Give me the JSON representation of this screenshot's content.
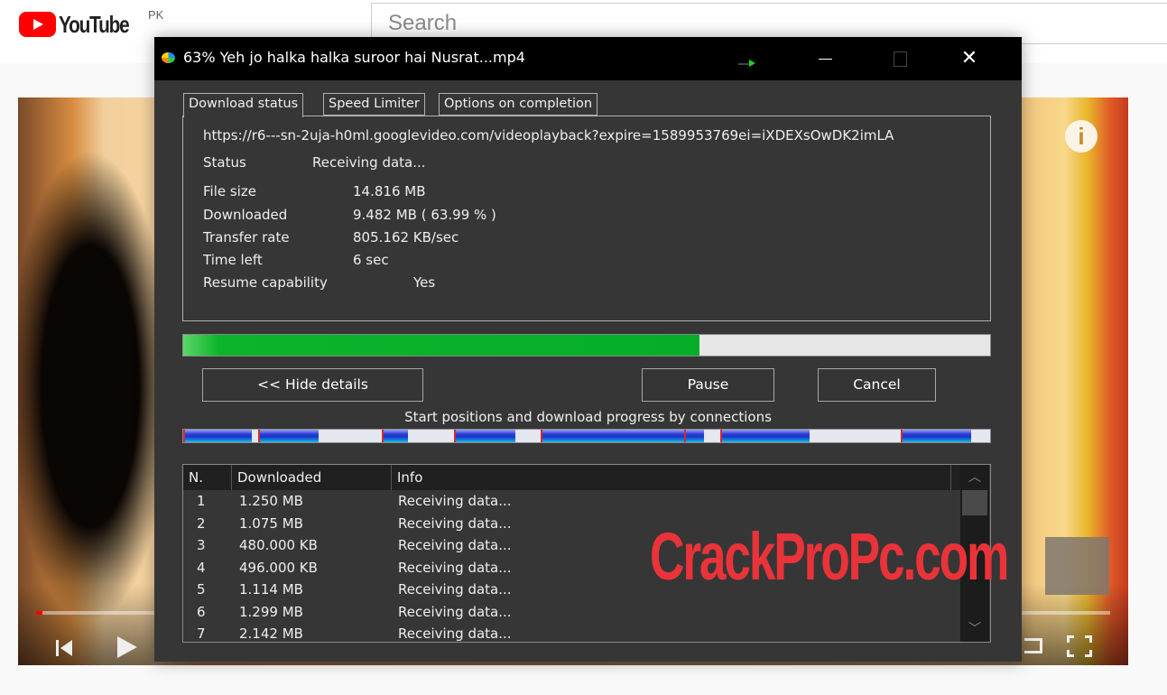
{
  "youtube": {
    "logo_text": "YouTube",
    "country_code": "PK",
    "search_placeholder": "Search",
    "video": {
      "played_fraction": 0.006,
      "info_icon": "i"
    }
  },
  "idm": {
    "title": "63% Yeh jo halka halka suroor hai Nusrat...mp4",
    "tabs": [
      {
        "label": "Download status",
        "active": true
      },
      {
        "label": "Speed Limiter",
        "active": false
      },
      {
        "label": "Options on completion",
        "active": false
      }
    ],
    "url": "https://r6---sn-2uja-h0ml.googlevideo.com/videoplayback?expire=1589953769ei=iXDEXsOwDK2imLA",
    "status": {
      "label": "Status",
      "value": "Receiving data..."
    },
    "details": [
      {
        "label": "File size",
        "value": "14.816  MB"
      },
      {
        "label": "Downloaded",
        "value": "9.482  MB  ( 63.99 % )"
      },
      {
        "label": "Transfer rate",
        "value": "805.162  KB/sec"
      },
      {
        "label": "Time left",
        "value": "6 sec"
      },
      {
        "label": "Resume capability",
        "value": "Yes"
      }
    ],
    "progress_percent": 63.99,
    "buttons": {
      "hide_details": "<< Hide details",
      "pause": "Pause",
      "cancel": "Cancel"
    },
    "connections_label": "Start positions and download progress by connections",
    "connections_bar": [
      {
        "start": 0.0,
        "done": 0.085
      },
      {
        "start": 0.093,
        "done": 0.075
      },
      {
        "start": 0.246,
        "done": 0.033
      },
      {
        "start": 0.336,
        "done": 0.076
      },
      {
        "start": 0.443,
        "done": 0.186
      },
      {
        "start": 0.621,
        "done": 0.024
      },
      {
        "start": 0.666,
        "done": 0.11
      },
      {
        "start": 0.889,
        "done": 0.087
      }
    ],
    "table": {
      "columns": [
        "N.",
        "Downloaded",
        "Info"
      ],
      "rows": [
        {
          "n": "1",
          "downloaded": "1.250  MB",
          "info": "Receiving data..."
        },
        {
          "n": "2",
          "downloaded": "1.075  MB",
          "info": "Receiving data..."
        },
        {
          "n": "3",
          "downloaded": "480.000  KB",
          "info": "Receiving data..."
        },
        {
          "n": "4",
          "downloaded": "496.000  KB",
          "info": "Receiving data..."
        },
        {
          "n": "5",
          "downloaded": "1.114  MB",
          "info": "Receiving data..."
        },
        {
          "n": "6",
          "downloaded": "1.299  MB",
          "info": "Receiving data..."
        },
        {
          "n": "7",
          "downloaded": "2.142  MB",
          "info": "Receiving data..."
        }
      ]
    }
  },
  "watermark": "CrackProPc.com",
  "colors": {
    "progress_green": "#05ae28",
    "watermark_red": "#ea3339",
    "youtube_red": "#ff0000",
    "connection_blue": "#1e32c8",
    "connection_marker": "#d42a2a"
  }
}
